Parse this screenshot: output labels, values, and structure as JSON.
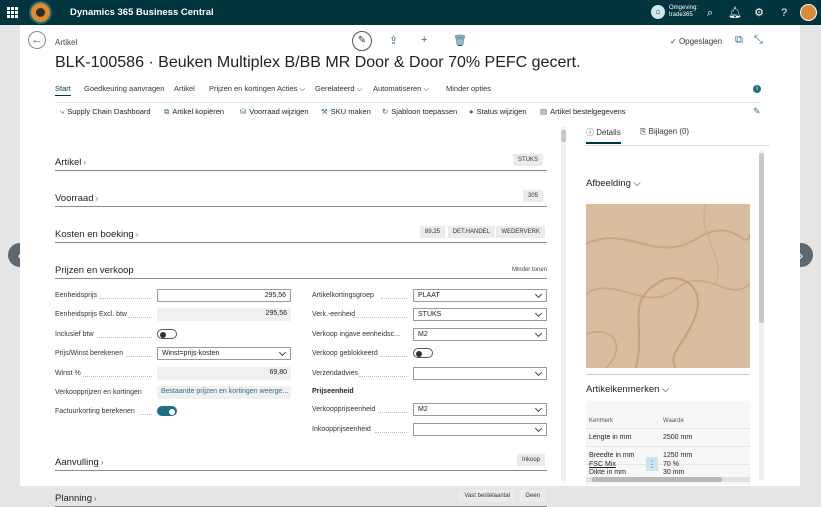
{
  "app": {
    "title": "Dynamics 365 Business Central",
    "environment_label": "Omgeving:",
    "environment_name": "trade365"
  },
  "header": {
    "breadcrumb": "Artikel",
    "saved_status": "Opgeslagen",
    "page_title": "BLK-100586 · Beuken Multiplex B/BB MR Door & Door 70% PEFC gecert."
  },
  "nav": {
    "tabs": [
      "Start",
      "Goedkeuring aanvragen",
      "Artikel",
      "Prijzen en kortingen",
      "Acties",
      "Gerelateerd",
      "Automatiseren",
      "Minder opties"
    ]
  },
  "actions": [
    "Supply Chain Dashboard",
    "Artikel kopiëren",
    "Voorraad wijzigen",
    "SKU maken",
    "Sjabloon toepassen",
    "Status wijzigen",
    "Artikel bestelgegevens"
  ],
  "sections": {
    "artikel": {
      "title": "Artikel",
      "pills": [
        "STUKS"
      ]
    },
    "voorraad": {
      "title": "Voorraad",
      "pills": [
        "305"
      ]
    },
    "kosten": {
      "title": "Kosten en boeking",
      "pills": [
        "89,25",
        "DET.HANDEL",
        "WEDERVERK"
      ]
    },
    "prijzen": {
      "title": "Prijzen en verkoop",
      "less": "Minder tonen"
    },
    "aanvulling": {
      "title": "Aanvulling",
      "pills": [
        "Inkoop"
      ]
    },
    "planning": {
      "title": "Planning",
      "pills": [
        "Vast bestelaantal",
        "Geen"
      ]
    }
  },
  "fields_left": {
    "eenheidsprijs": {
      "label": "Eenheidsprijs",
      "value": "295,56"
    },
    "eenheidsprijs_excl": {
      "label": "Eenheidsprijs Excl. btw",
      "value": "295,56"
    },
    "inclusief_btw": {
      "label": "Inclusief btw",
      "on": false
    },
    "prijs_winst": {
      "label": "Prijs/Winst berekenen",
      "value": "Winst=prijs-kosten"
    },
    "winst": {
      "label": "Winst %",
      "value": "69,80"
    },
    "verkoopprijzen": {
      "label": "Verkoopprijzen en kortingen",
      "value": "Bestaande prijzen en kortingen weerge..."
    },
    "factuurkorting": {
      "label": "Factuurkorting berekenen",
      "on": true
    }
  },
  "fields_right": {
    "artikelkortingsgroep": {
      "label": "Artikelkortingsgroep",
      "value": "PLAAT"
    },
    "verk_eenheid": {
      "label": "Verk.-eenheid",
      "value": "STUKS"
    },
    "verkoop_ingave": {
      "label": "Verkoop ingave eenheidsc...",
      "value": "M2"
    },
    "verkoop_geblokkeerd": {
      "label": "Verkoop geblokkeerd",
      "on": false
    },
    "verzendadvies": {
      "label": "Verzendadvies",
      "value": ""
    },
    "prijseenheid_head": "Prijseenheid",
    "verkoopprijseenheid": {
      "label": "Verkoopprijseenheid",
      "value": "M2"
    },
    "inkoopprijseenheid": {
      "label": "Inkoopprijseenheid",
      "value": ""
    }
  },
  "factbox": {
    "tab_details": "Details",
    "tab_attachments": "Bijlagen (0)",
    "afbeelding_title": "Afbeelding",
    "kenmerken_title": "Artikelkenmerken",
    "columns": [
      "Kenmerk",
      "Waarde"
    ],
    "rows": [
      {
        "k": "Lengte in mm",
        "v": "2500 mm"
      },
      {
        "k": "Breedte in mm",
        "v": "1250 mm"
      },
      {
        "k": "Dikte in mm",
        "v": "30 mm"
      },
      {
        "k": "FSC Mix",
        "v": "70 %"
      }
    ]
  }
}
